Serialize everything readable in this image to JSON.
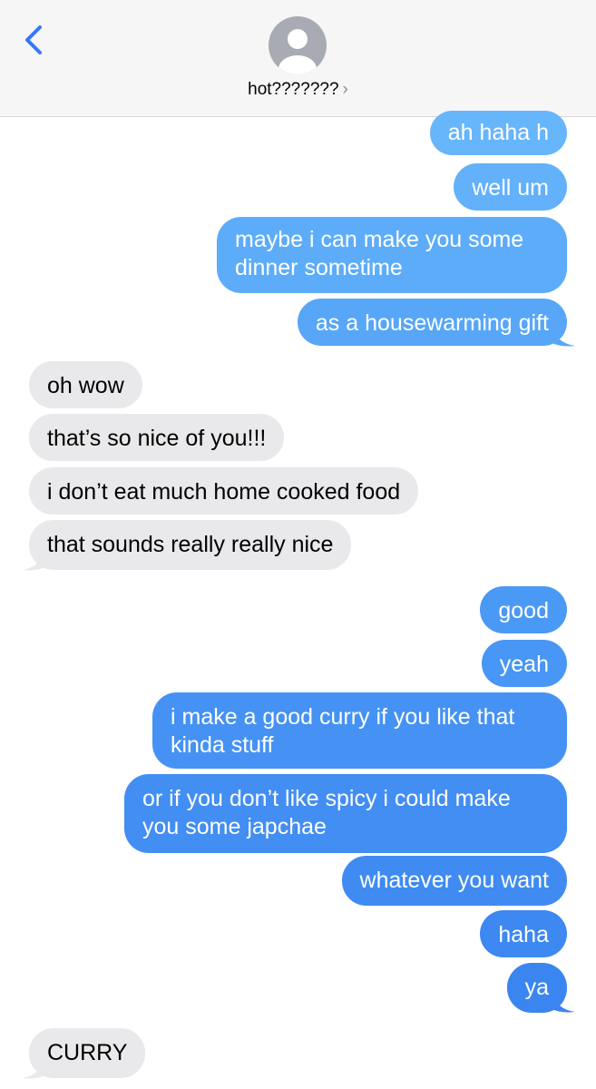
{
  "header": {
    "contact_name": "hot???????",
    "chevron": "›"
  },
  "messages": [
    {
      "side": "sent",
      "text": "ah haha h",
      "color": "#67b5fb"
    },
    {
      "side": "sent",
      "text": "well um",
      "color": "#62b1fa"
    },
    {
      "side": "sent",
      "text": "maybe i can make you some\ndinner sometime",
      "color": "#5dacf9"
    },
    {
      "side": "sent",
      "text": "as a housewarming gift",
      "color": "#57a6f8"
    },
    {
      "side": "received",
      "text": "oh wow"
    },
    {
      "side": "received",
      "text": "that’s so nice of you!!!"
    },
    {
      "side": "received",
      "text": "i don’t eat much home cooked food"
    },
    {
      "side": "received",
      "text": "that sounds really really nice"
    },
    {
      "side": "sent",
      "text": "good",
      "color": "#4a99f5"
    },
    {
      "side": "sent",
      "text": "yeah",
      "color": "#4896f5"
    },
    {
      "side": "sent",
      "text": "i make a good curry if you like that\nkinda stuff",
      "color": "#4592f4"
    },
    {
      "side": "sent",
      "text": "or if you don’t like spicy i could make\nyou some japchae",
      "color": "#428ef3"
    },
    {
      "side": "sent",
      "text": "whatever you want",
      "color": "#3f8bf2"
    },
    {
      "side": "sent",
      "text": "haha",
      "color": "#3d88f1"
    },
    {
      "side": "sent",
      "text": "ya",
      "color": "#3b85f1"
    },
    {
      "side": "received",
      "text": "CURRY"
    }
  ],
  "colors": {
    "received_bubble": "#e9e9eb",
    "accent": "#3478f6"
  },
  "icons": {
    "back": "chevron-left-icon",
    "avatar": "person-avatar-icon"
  }
}
